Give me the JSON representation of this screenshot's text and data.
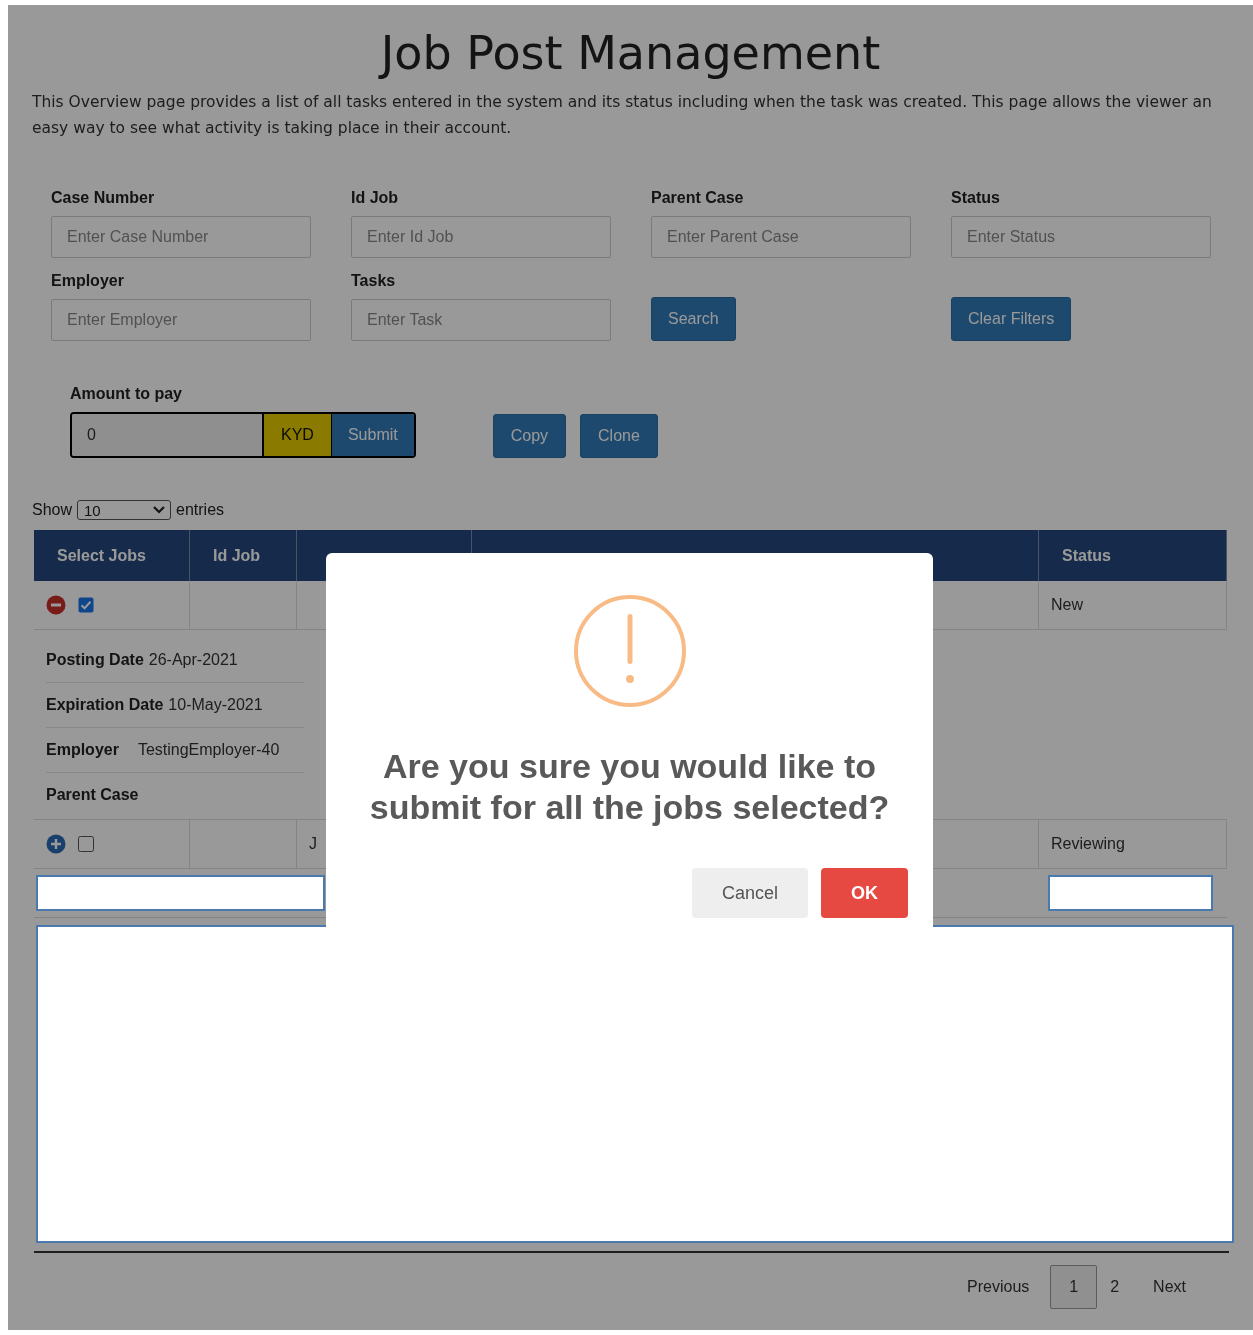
{
  "page": {
    "title": "Job Post Management",
    "description": "This Overview page provides a list of all tasks entered in the system and its status including when the task was created. This page allows the viewer an easy way to see what activity is taking place in their account."
  },
  "filters": [
    {
      "label": "Case Number",
      "placeholder": "Enter Case Number"
    },
    {
      "label": "Id Job",
      "placeholder": "Enter Id Job"
    },
    {
      "label": "Parent Case",
      "placeholder": "Enter Parent Case"
    },
    {
      "label": "Status",
      "placeholder": "Enter Status"
    },
    {
      "label": "Employer",
      "placeholder": "Enter Employer"
    },
    {
      "label": "Tasks",
      "placeholder": "Enter Task"
    }
  ],
  "filter_buttons": [
    "Search",
    "Clear Filters"
  ],
  "amount": {
    "label": "Amount to pay",
    "value": "0",
    "currency": "KYD",
    "submit": "Submit"
  },
  "actions": [
    "Copy",
    "Clone"
  ],
  "entries": {
    "show": "Show",
    "value": "10",
    "suffix": "entries"
  },
  "table": {
    "columns": [
      "Select Jobs",
      "Id Job",
      "Status"
    ],
    "rows": [
      {
        "expanded": true,
        "selected": true,
        "status": "New",
        "details": [
          {
            "label": "Posting Date",
            "value": "26-Apr-2021"
          },
          {
            "label": "Expiration Date",
            "value": "10-May-2021"
          },
          {
            "label": "Employer",
            "value": "TestingEmployer-40"
          },
          {
            "label": "Parent Case"
          }
        ]
      },
      {
        "expanded": false,
        "selected": false,
        "column_3": "J",
        "status": "Reviewing"
      }
    ]
  },
  "modal": {
    "message": "Are you sure you would like to submit for all the jobs selected?",
    "buttons": [
      {
        "label": "Cancel",
        "kind": "cancel"
      },
      {
        "label": "OK",
        "kind": "confirm"
      }
    ]
  },
  "pagination": {
    "previous": "Previous",
    "pages": [
      {
        "label": "1",
        "selected": true
      },
      {
        "label": "2",
        "selected": false
      }
    ],
    "next": "Next"
  }
}
